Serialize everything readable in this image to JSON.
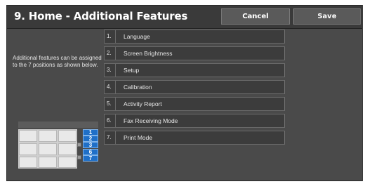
{
  "window": {
    "title": "9. Home - Additional Features",
    "cancel_label": "Cancel",
    "save_label": "Save"
  },
  "description": "Additional features can be assigned to the 7 positions as shown below.",
  "features": [
    {
      "number": "1.",
      "label": "Language"
    },
    {
      "number": "2.",
      "label": "Screen Brightness"
    },
    {
      "number": "3.",
      "label": "Setup"
    },
    {
      "number": "4.",
      "label": "Calibration"
    },
    {
      "number": "5.",
      "label": "Activity Report"
    },
    {
      "number": "6.",
      "label": "Fax Receiving Mode"
    },
    {
      "number": "7.",
      "label": "Print Mode"
    }
  ],
  "positions": [
    "1",
    "2",
    "3",
    "6",
    "7"
  ]
}
